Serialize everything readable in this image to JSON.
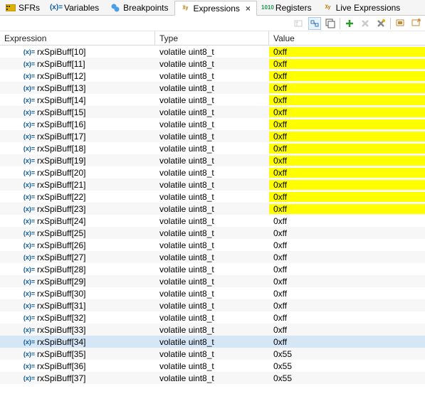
{
  "tabs": [
    {
      "label": "SFRs",
      "icon": "sfrs-icon",
      "active": false
    },
    {
      "label": "Variables",
      "icon": "variables-icon",
      "active": false
    },
    {
      "label": "Breakpoints",
      "icon": "breakpoints-icon",
      "active": false
    },
    {
      "label": "Expressions",
      "icon": "expressions-icon",
      "active": true
    },
    {
      "label": "Registers",
      "icon": "registers-icon",
      "active": false
    },
    {
      "label": "Live Expressions",
      "icon": "live-expressions-icon",
      "active": false
    }
  ],
  "close_glyph": "×",
  "columns": {
    "expr": "Expression",
    "type": "Type",
    "value": "Value"
  },
  "var_icon_label": "(x)=",
  "rows": [
    {
      "expr": "rxSpiBuff[10]",
      "type": "volatile uint8_t",
      "value": "0xff",
      "highlight": true,
      "selected": false
    },
    {
      "expr": "rxSpiBuff[11]",
      "type": "volatile uint8_t",
      "value": "0xff",
      "highlight": true,
      "selected": false
    },
    {
      "expr": "rxSpiBuff[12]",
      "type": "volatile uint8_t",
      "value": "0xff",
      "highlight": true,
      "selected": false
    },
    {
      "expr": "rxSpiBuff[13]",
      "type": "volatile uint8_t",
      "value": "0xff",
      "highlight": true,
      "selected": false
    },
    {
      "expr": "rxSpiBuff[14]",
      "type": "volatile uint8_t",
      "value": "0xff",
      "highlight": true,
      "selected": false
    },
    {
      "expr": "rxSpiBuff[15]",
      "type": "volatile uint8_t",
      "value": "0xff",
      "highlight": true,
      "selected": false
    },
    {
      "expr": "rxSpiBuff[16]",
      "type": "volatile uint8_t",
      "value": "0xff",
      "highlight": true,
      "selected": false
    },
    {
      "expr": "rxSpiBuff[17]",
      "type": "volatile uint8_t",
      "value": "0xff",
      "highlight": true,
      "selected": false
    },
    {
      "expr": "rxSpiBuff[18]",
      "type": "volatile uint8_t",
      "value": "0xff",
      "highlight": true,
      "selected": false
    },
    {
      "expr": "rxSpiBuff[19]",
      "type": "volatile uint8_t",
      "value": "0xff",
      "highlight": true,
      "selected": false
    },
    {
      "expr": "rxSpiBuff[20]",
      "type": "volatile uint8_t",
      "value": "0xff",
      "highlight": true,
      "selected": false
    },
    {
      "expr": "rxSpiBuff[21]",
      "type": "volatile uint8_t",
      "value": "0xff",
      "highlight": true,
      "selected": false
    },
    {
      "expr": "rxSpiBuff[22]",
      "type": "volatile uint8_t",
      "value": "0xff",
      "highlight": true,
      "selected": false
    },
    {
      "expr": "rxSpiBuff[23]",
      "type": "volatile uint8_t",
      "value": "0xff",
      "highlight": true,
      "selected": false
    },
    {
      "expr": "rxSpiBuff[24]",
      "type": "volatile uint8_t",
      "value": "0xff",
      "highlight": false,
      "selected": false
    },
    {
      "expr": "rxSpiBuff[25]",
      "type": "volatile uint8_t",
      "value": "0xff",
      "highlight": false,
      "selected": false
    },
    {
      "expr": "rxSpiBuff[26]",
      "type": "volatile uint8_t",
      "value": "0xff",
      "highlight": false,
      "selected": false
    },
    {
      "expr": "rxSpiBuff[27]",
      "type": "volatile uint8_t",
      "value": "0xff",
      "highlight": false,
      "selected": false
    },
    {
      "expr": "rxSpiBuff[28]",
      "type": "volatile uint8_t",
      "value": "0xff",
      "highlight": false,
      "selected": false
    },
    {
      "expr": "rxSpiBuff[29]",
      "type": "volatile uint8_t",
      "value": "0xff",
      "highlight": false,
      "selected": false
    },
    {
      "expr": "rxSpiBuff[30]",
      "type": "volatile uint8_t",
      "value": "0xff",
      "highlight": false,
      "selected": false
    },
    {
      "expr": "rxSpiBuff[31]",
      "type": "volatile uint8_t",
      "value": "0xff",
      "highlight": false,
      "selected": false
    },
    {
      "expr": "rxSpiBuff[32]",
      "type": "volatile uint8_t",
      "value": "0xff",
      "highlight": false,
      "selected": false
    },
    {
      "expr": "rxSpiBuff[33]",
      "type": "volatile uint8_t",
      "value": "0xff",
      "highlight": false,
      "selected": false
    },
    {
      "expr": "rxSpiBuff[34]",
      "type": "volatile uint8_t",
      "value": "0xff",
      "highlight": false,
      "selected": true
    },
    {
      "expr": "rxSpiBuff[35]",
      "type": "volatile uint8_t",
      "value": "0x55",
      "highlight": false,
      "selected": false
    },
    {
      "expr": "rxSpiBuff[36]",
      "type": "volatile uint8_t",
      "value": "0x55",
      "highlight": false,
      "selected": false
    },
    {
      "expr": "rxSpiBuff[37]",
      "type": "volatile uint8_t",
      "value": "0x55",
      "highlight": false,
      "selected": false
    }
  ]
}
